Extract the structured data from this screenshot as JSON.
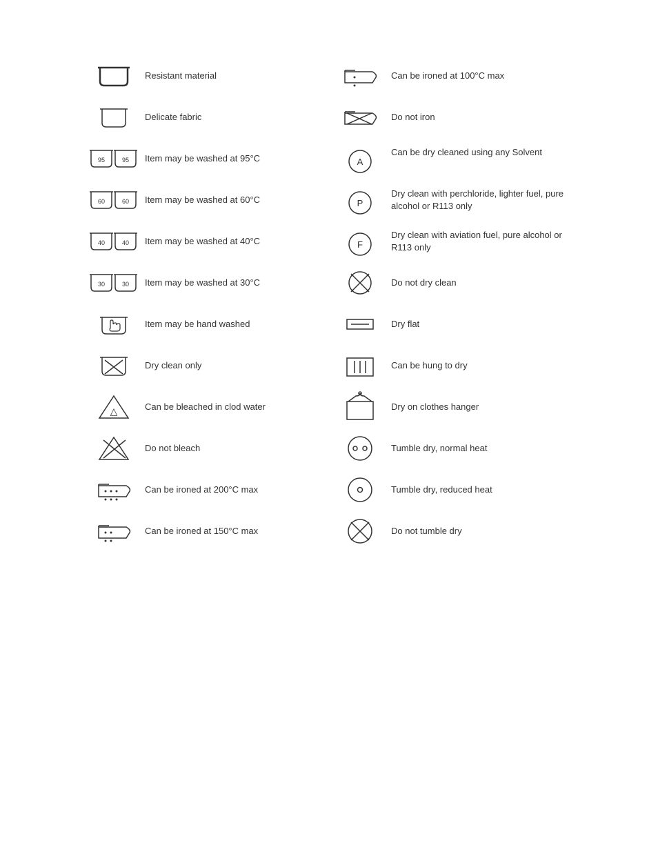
{
  "left_items": [
    {
      "id": "resistant-material",
      "label": "Resistant material"
    },
    {
      "id": "delicate-fabric",
      "label": "Delicate fabric"
    },
    {
      "id": "wash-95",
      "label": "Item may be washed at 95°C"
    },
    {
      "id": "wash-60",
      "label": "Item may be washed at 60°C"
    },
    {
      "id": "wash-40",
      "label": "Item may be washed at 40°C"
    },
    {
      "id": "wash-30",
      "label": "Item may be washed at 30°C"
    },
    {
      "id": "hand-wash",
      "label": "Item may be hand washed"
    },
    {
      "id": "dry-clean-only",
      "label": "Dry clean only"
    },
    {
      "id": "bleach-cold",
      "label": "Can be bleached in clod water"
    },
    {
      "id": "no-bleach",
      "label": "Do not bleach"
    },
    {
      "id": "iron-200",
      "label": "Can be ironed at 200°C max"
    },
    {
      "id": "iron-150",
      "label": "Can be ironed at 150°C max"
    }
  ],
  "right_items": [
    {
      "id": "iron-100",
      "label": "Can be ironed at 100°C  max"
    },
    {
      "id": "no-iron",
      "label": "Do not iron"
    },
    {
      "id": "dry-clean-any",
      "label": "Can be dry cleaned using any Solvent"
    },
    {
      "id": "dry-clean-p",
      "label": "Dry clean with perchloride, lighter fuel, pure alcohol or R113 only"
    },
    {
      "id": "dry-clean-f",
      "label": "Dry clean with aviation fuel, pure alcohol or R113 only"
    },
    {
      "id": "no-dry-clean",
      "label": "Do not dry clean"
    },
    {
      "id": "dry-flat",
      "label": "Dry flat"
    },
    {
      "id": "hang-dry",
      "label": "Can be hung to dry"
    },
    {
      "id": "hanger-dry",
      "label": "Dry on clothes hanger"
    },
    {
      "id": "tumble-normal",
      "label": "Tumble dry, normal heat"
    },
    {
      "id": "tumble-reduced",
      "label": "Tumble dry, reduced heat"
    },
    {
      "id": "no-tumble",
      "label": "Do not tumble dry"
    }
  ]
}
